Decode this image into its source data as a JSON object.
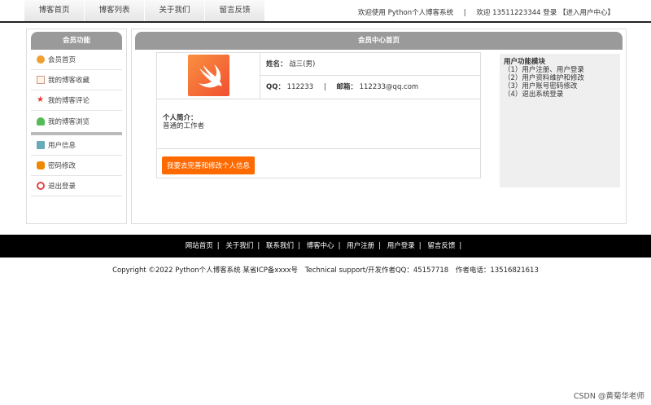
{
  "nav": {
    "tabs": [
      "博客首页",
      "博客列表",
      "关于我们",
      "留言反馈"
    ],
    "welcome": "欢迎使用 Python个人博客系统",
    "user_greeting": "欢迎 13511223344 登录",
    "user_center_link": "【进入用户中心】"
  },
  "sidebar": {
    "title": "会员功能",
    "items": [
      {
        "label": "会员首页",
        "icon": "home-icon"
      },
      {
        "label": "我的博客收藏",
        "icon": "favorite-icon"
      },
      {
        "label": "我的博客评论",
        "icon": "star-icon"
      },
      {
        "label": "我的博客浏览",
        "icon": "browse-icon"
      }
    ],
    "items2": [
      {
        "label": "用户信息",
        "icon": "user-icon"
      },
      {
        "label": "密码修改",
        "icon": "lock-icon"
      },
      {
        "label": "退出登录",
        "icon": "power-icon"
      }
    ]
  },
  "main": {
    "title": "会员中心首页",
    "name_label": "姓名：",
    "name_value": "战三(男)",
    "qq_label": "QQ：",
    "qq_value": "112233",
    "sep": "|",
    "email_label": "邮箱：",
    "email_value": "112233@qq.com",
    "intro_label": "个人简介：",
    "intro_value": "普通的工作者",
    "edit_button": "我要去完善和修改个人信息"
  },
  "module": {
    "title": "用户功能模块",
    "lines": [
      "（1）用户注册、用户登录",
      "（2）用户资料维护和修改",
      "（3）用户账号密码修改",
      "（4）退出系统登录"
    ]
  },
  "footer": {
    "links": [
      "网站首页",
      "关于我们",
      "联系我们",
      "博客中心",
      "用户注册",
      "用户登录",
      "留言反馈"
    ],
    "sep": "|",
    "copyright": "Copyright ©2022 Python个人博客系统 某省ICP备xxxx号",
    "support": "Technical support/开发作者QQ：45157718",
    "phone": "作者电话：13516821613"
  },
  "watermark": "CSDN @黄菊华老师",
  "colors": {
    "accent": "#ff6a00",
    "header_gray": "#9a9a9a",
    "footer_bg": "#000000"
  }
}
